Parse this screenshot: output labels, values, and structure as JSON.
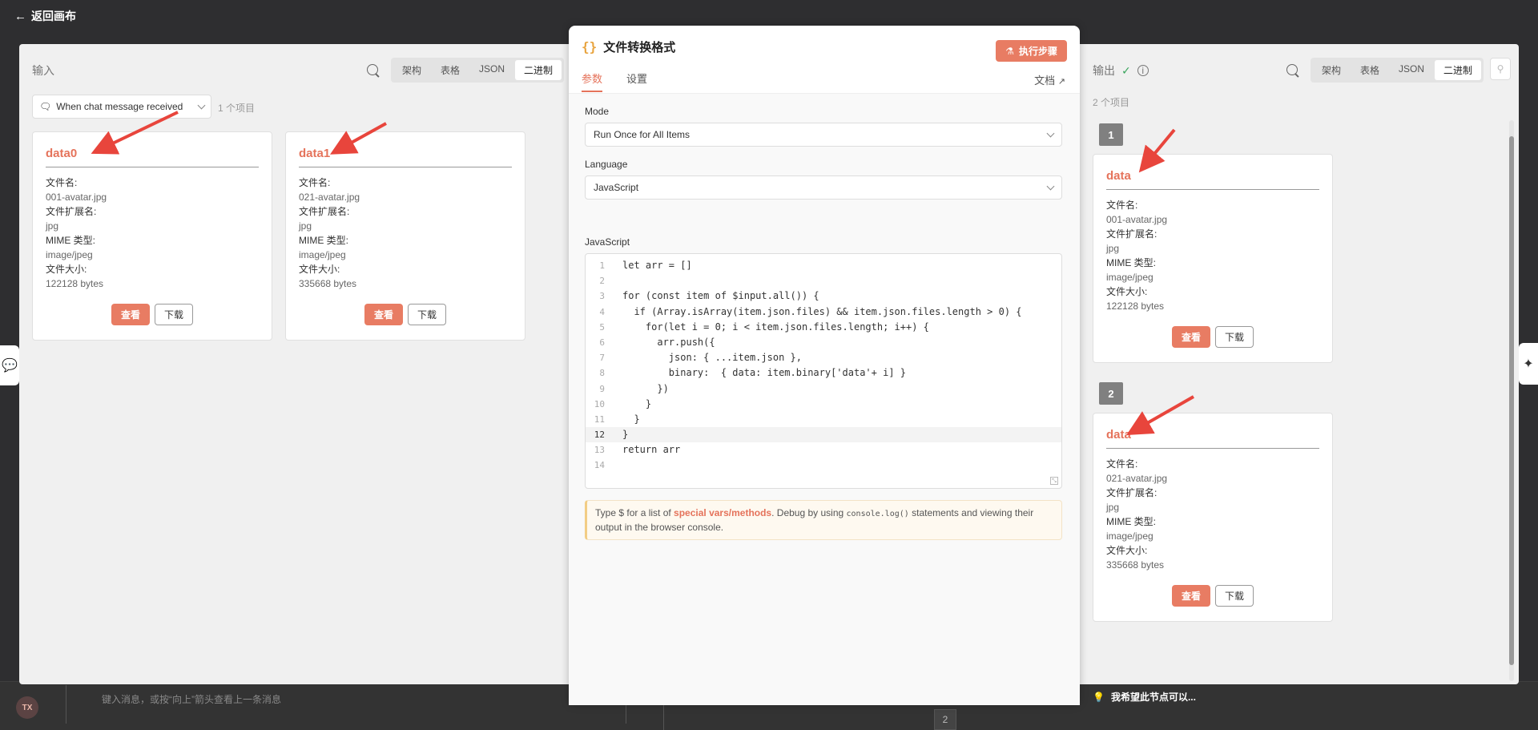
{
  "backdrop": {
    "back_label": "返回画布",
    "chat_placeholder": "键入消息，或按“向上”箭头查看上一条消息",
    "chat_badge": "2",
    "suggest_label": "我希望此节点可以..."
  },
  "input_panel": {
    "title": "输入",
    "view_tabs": [
      "架构",
      "表格",
      "JSON",
      "二进制"
    ],
    "active_tab": "二进制",
    "source_select": "When chat message received",
    "item_count": "1 个项目",
    "cards": [
      {
        "title": "data0",
        "file_name_label": "文件名:",
        "file_name": "001-avatar.jpg",
        "ext_label": "文件扩展名:",
        "ext": "jpg",
        "mime_label": "MIME 类型:",
        "mime": "image/jpeg",
        "size_label": "文件大小:",
        "size": "122128 bytes",
        "view_btn": "查看",
        "download_btn": "下载"
      },
      {
        "title": "data1",
        "file_name_label": "文件名:",
        "file_name": "021-avatar.jpg",
        "ext_label": "文件扩展名:",
        "ext": "jpg",
        "mime_label": "MIME 类型:",
        "mime": "image/jpeg",
        "size_label": "文件大小:",
        "size": "335668 bytes",
        "view_btn": "查看",
        "download_btn": "下载"
      }
    ]
  },
  "node": {
    "icon": "{}",
    "title": "文件转换格式",
    "execute_btn": "执行步骤",
    "tabs": [
      "参数",
      "设置"
    ],
    "active_tab": "参数",
    "docs_label": "文档",
    "mode_label": "Mode",
    "mode_value": "Run Once for All Items",
    "language_label": "Language",
    "language_value": "JavaScript",
    "code_label": "JavaScript",
    "current_line": 12,
    "code_lines": [
      "let arr = []",
      "",
      "for (const item of $input.all()) {",
      "  if (Array.isArray(item.json.files) && item.json.files.length > 0) {",
      "    for(let i = 0; i < item.json.files.length; i++) {",
      "      arr.push({",
      "        json: { ...item.json },",
      "        binary:  { data: item.binary['data'+ i] }",
      "      })",
      "    }",
      "  }",
      "}",
      "return arr",
      ""
    ],
    "hint": {
      "prefix": "Type $ for a list of ",
      "highlight": "special vars/methods",
      "middle": ". Debug by using ",
      "code": "console.log()",
      "suffix": " statements and viewing their output in the browser console."
    }
  },
  "output_panel": {
    "title": "输出",
    "view_tabs": [
      "架构",
      "表格",
      "JSON",
      "二进制"
    ],
    "active_tab": "二进制",
    "item_count": "2 个项目",
    "items": [
      {
        "index": "1",
        "title": "data",
        "file_name_label": "文件名:",
        "file_name": "001-avatar.jpg",
        "ext_label": "文件扩展名:",
        "ext": "jpg",
        "mime_label": "MIME 类型:",
        "mime": "image/jpeg",
        "size_label": "文件大小:",
        "size": "122128 bytes",
        "view_btn": "查看",
        "download_btn": "下载"
      },
      {
        "index": "2",
        "title": "data",
        "file_name_label": "文件名:",
        "file_name": "021-avatar.jpg",
        "ext_label": "文件扩展名:",
        "ext": "jpg",
        "mime_label": "MIME 类型:",
        "mime": "image/jpeg",
        "size_label": "文件大小:",
        "size": "335668 bytes",
        "view_btn": "查看",
        "download_btn": "下载"
      }
    ]
  },
  "colors": {
    "accent": "#e87c63",
    "title_red": "#e5735b",
    "annotation_arrow": "#e8453c",
    "success": "#3aa55d"
  }
}
